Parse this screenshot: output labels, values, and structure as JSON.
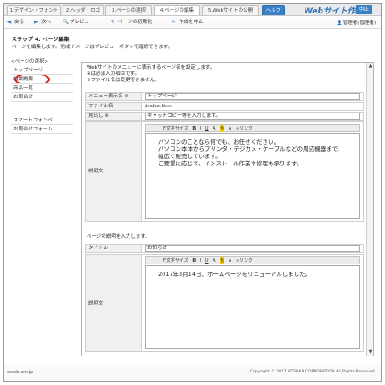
{
  "tabs": [
    "1.デザイン・フォント",
    "2.ヘッダ・ロゴ",
    "3.ページの選択",
    "4.ページの編集",
    "5.Webサイトの公開",
    "ヘルプ"
  ],
  "app_title": "Webサイト作成",
  "suspend_label": "中止",
  "toolbar": {
    "back": "戻る",
    "next": "次へ",
    "preview": "プレビュー",
    "reset": "ページの初期化",
    "cancel": "作成を中止",
    "user": "管理者(管理者)"
  },
  "step": {
    "title": "ステップ 4. ページ編集",
    "desc": "ページを編集します。完成イメージはプレビューボタンで確認できます。"
  },
  "sidebar": {
    "heading": "<ページの選択>",
    "items": [
      "トップページ",
      "組織概要",
      "商品一覧",
      "お問合せ"
    ],
    "items2": [
      "スマートフォンペ...",
      "お問合せフォーム"
    ]
  },
  "main": {
    "intro": [
      "Webサイトのメニューに表示するページ名を設定します。",
      "※は必須入力項目です。",
      "※ファイル名は変更できません。"
    ],
    "menu_label": "メニュー表示名 ※",
    "menu_value": "トップページ",
    "file_label": "ファイル名",
    "file_value": "/index.html",
    "heading_label": "見出し ※",
    "heading_value": "キャッチコピー等を入力します。",
    "desc_label": "説明文",
    "editor_tools": [
      "F文字サイズ",
      "B",
      "I",
      "U",
      "A",
      "色",
      "A",
      "∞リンク"
    ],
    "desc_lines": [
      "パソコンのことなら何でも、お任せください。",
      "パソコン本体からプリンタ・デジカメ・ケーブルなどの周辺機器まで、",
      "幅広く販売しています。",
      "ご要望に応じて、インストール作業や修理も承ります。"
    ],
    "section2": "ページの説明を入力します。",
    "title_label": "タイトル",
    "title_value": "お知らせ",
    "desc2_label": "説明文",
    "desc2_text": "2017年3月14日、ホームページをリニューアルしました。"
  },
  "footer": {
    "left": "aweb.pm.jp",
    "right": "Copyright © 2017 OTSUKA CORPORATION All Rights Reserved."
  },
  "colors": {
    "accent": "#2f6fb5",
    "highlight": "#d9231f"
  }
}
